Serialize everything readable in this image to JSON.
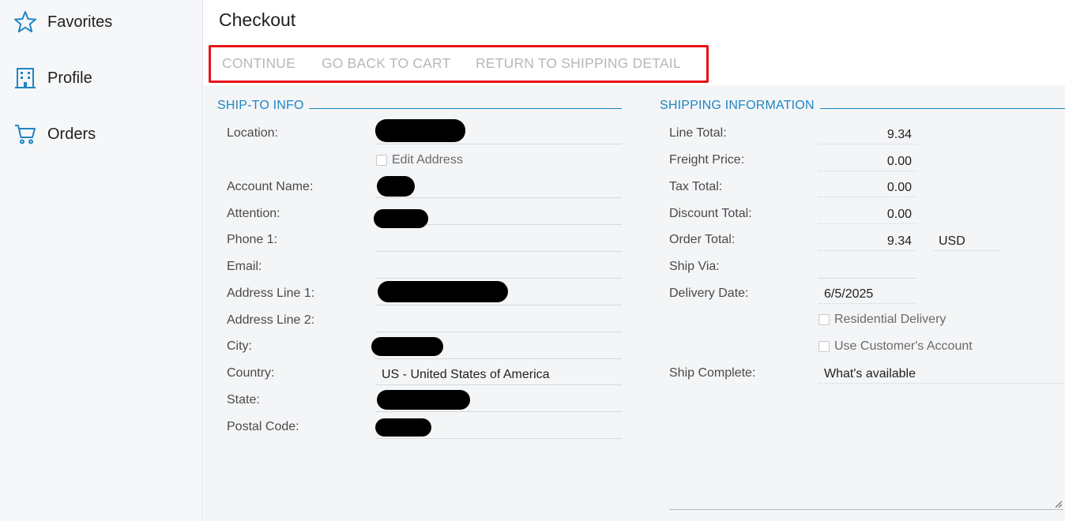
{
  "sidebar": {
    "items": [
      {
        "label": "Favorites",
        "icon": "star-icon"
      },
      {
        "label": "Profile",
        "icon": "building-icon"
      },
      {
        "label": "Orders",
        "icon": "cart-icon"
      }
    ]
  },
  "page": {
    "title": "Checkout"
  },
  "toolbar": {
    "continue_label": "CONTINUE",
    "back_label": "GO BACK TO CART",
    "return_label": "RETURN TO SHIPPING DETAIL"
  },
  "ship_to": {
    "heading": "SHIP-TO INFO",
    "fields": {
      "location": {
        "label": "Location:",
        "value": ""
      },
      "edit_address": {
        "label": "Edit Address",
        "checked": false
      },
      "account_name": {
        "label": "Account Name:",
        "value": ""
      },
      "attention": {
        "label": "Attention:",
        "value": ""
      },
      "phone1": {
        "label": "Phone 1:",
        "value": ""
      },
      "email": {
        "label": "Email:",
        "value": ""
      },
      "address1": {
        "label": "Address Line 1:",
        "value": ""
      },
      "address2": {
        "label": "Address Line 2:",
        "value": ""
      },
      "city": {
        "label": "City:",
        "value": ""
      },
      "country": {
        "label": "Country:",
        "value": "US - United States of America"
      },
      "state": {
        "label": "State:",
        "value": ""
      },
      "postal_code": {
        "label": "Postal Code:",
        "value": ""
      }
    }
  },
  "shipping": {
    "heading": "SHIPPING INFORMATION",
    "line_total": {
      "label": "Line Total:",
      "value": "9.34"
    },
    "freight_price": {
      "label": "Freight Price:",
      "value": "0.00"
    },
    "tax_total": {
      "label": "Tax Total:",
      "value": "0.00"
    },
    "discount_total": {
      "label": "Discount Total:",
      "value": "0.00"
    },
    "order_total": {
      "label": "Order Total:",
      "value": "9.34",
      "currency": "USD"
    },
    "ship_via": {
      "label": "Ship Via:",
      "value": ""
    },
    "delivery_date": {
      "label": "Delivery Date:",
      "value": "6/5/2025"
    },
    "residential_delivery": {
      "label": "Residential Delivery",
      "checked": false
    },
    "use_customer_account": {
      "label": "Use Customer's Account",
      "checked": false
    },
    "ship_complete": {
      "label": "Ship Complete:",
      "value": "What's available"
    }
  },
  "colors": {
    "accent": "#1f86c3",
    "highlight_border": "#e8131b",
    "disabled_text": "#b7b7b7"
  }
}
